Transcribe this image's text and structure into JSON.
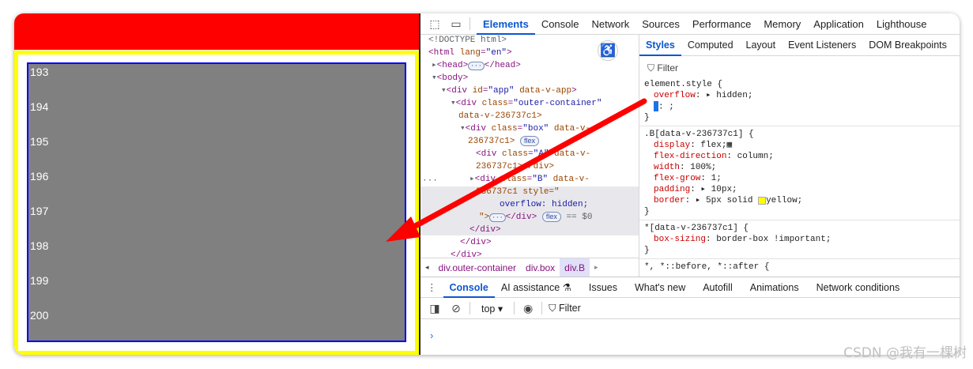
{
  "page": {
    "numbers": [
      "193",
      "194",
      "195",
      "196",
      "197",
      "198",
      "199",
      "200"
    ],
    "colors": {
      "header": "#ff0000",
      "border": "#ffff00",
      "box_border": "#0000ff",
      "box_bg": "#808080"
    }
  },
  "devtools": {
    "tabs": [
      "Elements",
      "Console",
      "Network",
      "Sources",
      "Performance",
      "Memory",
      "Application",
      "Lighthouse"
    ],
    "active_tab": "Elements",
    "dom": {
      "l1": "<!DOCTYPE html>",
      "l2_tag": "<html ",
      "l2_attr": "lang",
      "l2_val": "\"en\"",
      "l2_end": ">",
      "l3": "<head>",
      "l3_end": "</head>",
      "l4": "<body>",
      "l5_tag": "<div ",
      "l5_attr": "id",
      "l5_val": "\"app\"",
      "l5_attr2": " data-v-app",
      "l5_end": ">",
      "l6_tag": "<div ",
      "l6_attr": "class",
      "l6_val": "\"outer-container\"",
      "l7": "data-v-236737c1>",
      "l8_tag": "<div ",
      "l8_attr": "class",
      "l8_val": "\"box\"",
      "l8_attr2": " data-v-",
      "l9": "236737c1>",
      "l9_pill": "flex",
      "l10_tag": "<div ",
      "l10_attr": "class",
      "l10_val": "\"A\"",
      "l10_attr2": " data-v-",
      "l11": "236737c1></div>",
      "l12_tag": "<div ",
      "l12_attr": "class",
      "l12_val": "\"B\"",
      "l12_attr2": " data-v-",
      "l13": "236737c1 style=\"",
      "l14": "overflow: hidden;",
      "l15": "\">",
      "l15_end": "</div>",
      "l15_pill": "flex",
      "l15_eq": "== $0",
      "l16": "</div>",
      "l17": "</div>",
      "l18": "</div>"
    },
    "breadcrumbs": [
      "div.outer-container",
      "div.box",
      "div.B"
    ],
    "styles_tabs": [
      "Styles",
      "Computed",
      "Layout",
      "Event Listeners",
      "DOM Breakpoints"
    ],
    "filter_placeholder": "Filter",
    "rules": {
      "r1_sel": "element.style {",
      "r1_p1": "overflow",
      "r1_v1": "hidden;",
      "r1_p2": ": ;",
      "r1_close": "}",
      "r2_sel": ".B[data-v-236737c1] {",
      "r2_p1": "display",
      "r2_v1": "flex;",
      "r2_p2": "flex-direction",
      "r2_v2": "column;",
      "r2_p3": "width",
      "r2_v3": "100%;",
      "r2_p4": "flex-grow",
      "r2_v4": "1;",
      "r2_p5": "padding",
      "r2_v5": "10px;",
      "r2_p6": "border",
      "r2_v6a": "5px solid",
      "r2_v6b": "yellow;",
      "r2_close": "}",
      "r3_sel": "*[data-v-236737c1] {",
      "r3_p1": "box-sizing",
      "r3_v1": "border-box !important;",
      "r3_close": "}",
      "r4_sel": "*, *::before, *::after {"
    },
    "drawer_tabs": [
      "Console",
      "AI assistance",
      "Issues",
      "What's new",
      "Autofill",
      "Animations",
      "Network conditions"
    ],
    "console": {
      "context": "top ▾",
      "filter": "Filter",
      "prompt": "›"
    }
  },
  "watermark": "CSDN @我有一棵树",
  "arrow_color": "#ff0000"
}
